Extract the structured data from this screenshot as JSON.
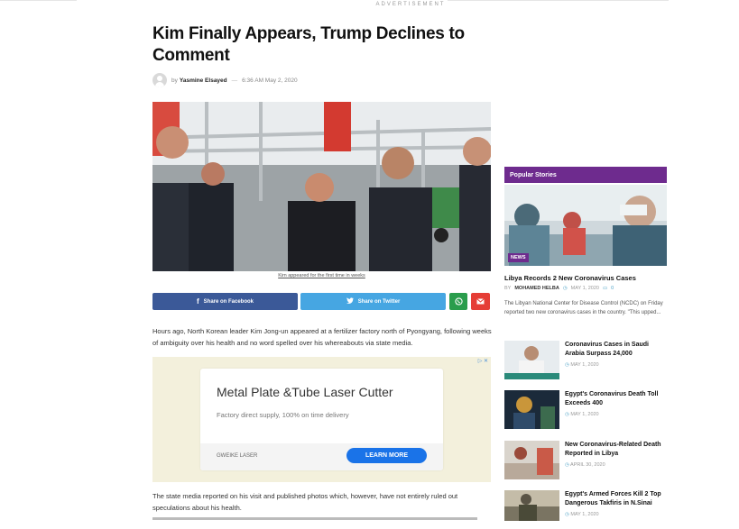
{
  "advertisement_label": "ADVERTISEMENT",
  "article": {
    "title": "Kim Finally Appears, Trump Declines to Comment",
    "by_label": "by",
    "author": "Yasmine Elsayed",
    "meta_separator": "—",
    "datetime": "6:36 AM May 2, 2020",
    "image_caption": "Kim appeared for the first time in weeks",
    "paragraph_1": "Hours ago, North Korean leader Kim Jong-un appeared at a fertilizer factory north of Pyongyang, following weeks of ambiguity over his health and no word spelled over his whereabouts via state media.",
    "paragraph_2": "The state media reported on his visit and published photos which, however, have not entirely ruled out speculations about his health."
  },
  "share": {
    "facebook_label": "Share on Facebook",
    "twitter_label": "Share on Twitter",
    "colors": {
      "facebook": "#3b5998",
      "twitter": "#46a6e2",
      "whatsapp": "#2a9d4c",
      "email": "#e53d36"
    }
  },
  "ad": {
    "headline": "Metal Plate &Tube Laser Cutter",
    "subtext": "Factory direct supply, 100% on time delivery",
    "brand": "GWEIKE LASER",
    "cta": "LEARN MORE"
  },
  "sidebar": {
    "header": "Popular Stories",
    "accent_color": "#6e2b8e",
    "featured": {
      "badge": "NEWS",
      "title": "Libya Records 2 New Coronavirus Cases",
      "by_label": "BY",
      "author": "MOHAMED HELBA",
      "date": "MAY 1, 2020",
      "comments": "0",
      "excerpt": "The Libyan National Center for Disease Control (NCDC) on Friday reported two new coronavirus cases in the country. \"This upped..."
    },
    "items": [
      {
        "title": "Coronavirus Cases in Saudi Arabia Surpass 24,000",
        "date": "MAY 1, 2020"
      },
      {
        "title": "Egypt's Coronavirus Death Toll Exceeds 400",
        "date": "MAY 1, 2020"
      },
      {
        "title": "New Coronavirus-Related Death Reported in Libya",
        "date": "APRIL 30, 2020"
      },
      {
        "title": "Egypt's Armed Forces Kill 2 Top Dangerous Takfiris in N.Sinai",
        "date": "MAY 1, 2020"
      }
    ]
  }
}
